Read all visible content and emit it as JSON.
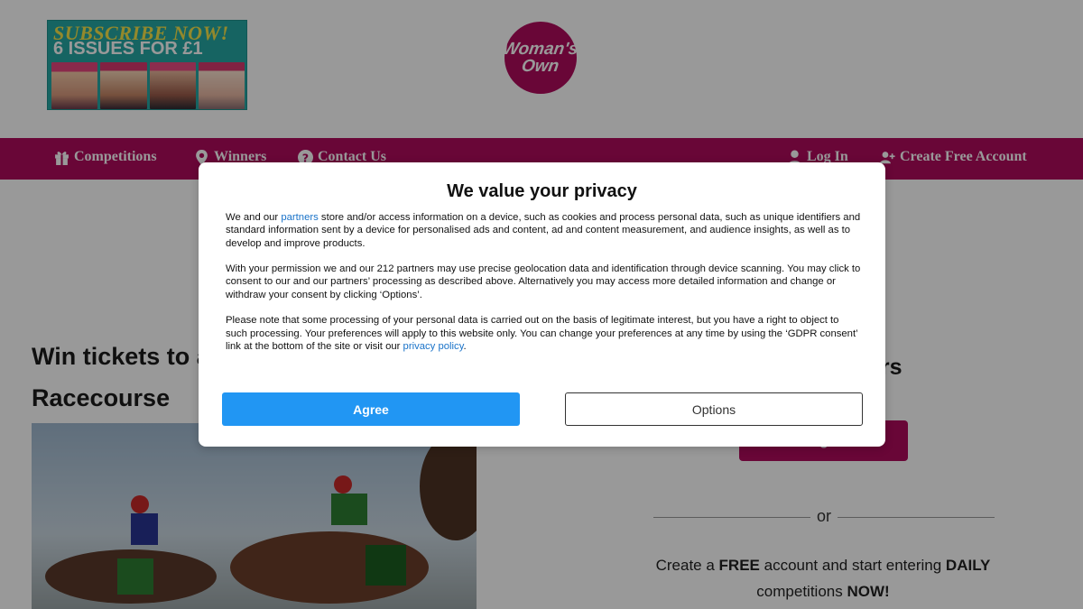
{
  "header": {
    "promo": {
      "line1": "SUBSCRIBE NOW!",
      "line2": "6 ISSUES FOR £1"
    },
    "logo": {
      "line1": "Woman's",
      "line2": "Own"
    }
  },
  "nav": {
    "competitions": "Competitions",
    "winners": "Winners",
    "contact": "Contact Us",
    "login": "Log In",
    "create_account": "Create Free Account"
  },
  "content": {
    "title_line1": "Win tickets to a",
    "title_line2": "Racecourse",
    "right_heading": "ers",
    "login_button": "Log In",
    "or": "or",
    "cta": {
      "p1": "Create a ",
      "free": "FREE",
      "p2": " account and start entering ",
      "daily": "DAILY",
      "p3": "competitions ",
      "now": "NOW!"
    }
  },
  "consent": {
    "title": "We value your privacy",
    "p1_a": "We and our ",
    "p1_link": "partners",
    "p1_b": " store and/or access information on a device, such as cookies and process personal data, such as unique identifiers and standard information sent by a device for personalised ads and content, ad and content measurement, and audience insights, as well as to develop and improve products.",
    "p2": "With your permission we and our 212 partners may use precise geolocation data and identification through device scanning. You may click to consent to our and our partners’ processing as described above. Alternatively you may access more detailed information and change or withdraw your consent by clicking ‘Options’.",
    "p3_a": "Please note that some processing of your personal data is carried out on the basis of legitimate interest, but you have a right to object to such processing. Your preferences will apply to this website only. You can change your preferences at any time by using the ‘GDPR consent’ link at the bottom of the site or visit our ",
    "p3_link": "privacy policy",
    "p3_b": ".",
    "agree_label": "Agree",
    "options_label": "Options"
  },
  "colors": {
    "brand": "#b00a5c",
    "agree": "#2196f3",
    "link": "#1a73c9"
  }
}
